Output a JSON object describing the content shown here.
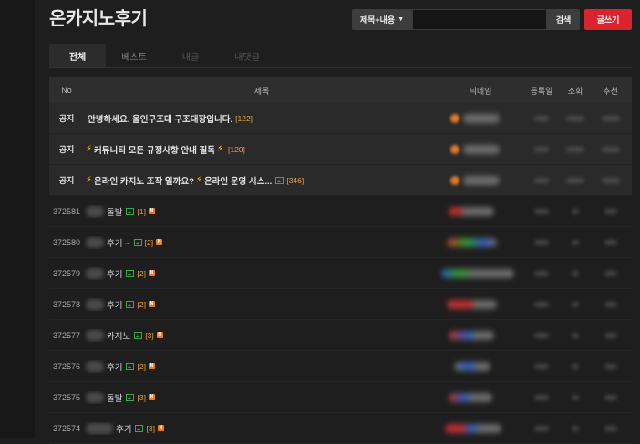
{
  "header": {
    "title": "온카지노후기",
    "search_scope": "제목+내용",
    "search_placeholder": "",
    "search_button": "검색",
    "write_button": "글쓰기"
  },
  "tabs": [
    {
      "label": "전체",
      "active": true
    },
    {
      "label": "베스트",
      "active": false
    },
    {
      "label": "내글",
      "active": false
    },
    {
      "label": "내댓글",
      "active": false
    }
  ],
  "table": {
    "columns": {
      "no": "No",
      "title": "제목",
      "nick": "닉네임",
      "date": "등록일",
      "views": "조회",
      "recommend": "추천"
    },
    "notices": [
      {
        "no": "공지",
        "title": "안녕하세요. 올인구조대 구조대장입니다.",
        "comments": "[122]"
      },
      {
        "no": "공지",
        "title": "커뮤니티 모든 규정사항 안내 필독",
        "comments": "[120]"
      },
      {
        "no": "공지",
        "title": "온라인 카지노 조작 일까요?",
        "title2": "온라인 운영 시스...",
        "comments": "[346]"
      }
    ],
    "posts": [
      {
        "no": "372581",
        "title": "돌발",
        "comments": "[1]"
      },
      {
        "no": "372580",
        "title": "후기 ~",
        "comments": "[2]"
      },
      {
        "no": "372579",
        "title": "후기",
        "comments": "[2]"
      },
      {
        "no": "372578",
        "title": "후기",
        "comments": "[2]"
      },
      {
        "no": "372577",
        "title": "카지노",
        "comments": "[3]"
      },
      {
        "no": "372576",
        "title": "후기",
        "comments": "[2]"
      },
      {
        "no": "372575",
        "title": "돌발",
        "comments": "[3]"
      },
      {
        "no": "372574",
        "title": "후기",
        "comments": "[3]"
      }
    ]
  },
  "colors": {
    "accent": "#d9232d",
    "comment": "#e8a23b",
    "image_icon": "#3aa84a",
    "new_badge": "#f07a1b"
  },
  "icons": {
    "bolt": "⚡",
    "new_badge": "N"
  }
}
